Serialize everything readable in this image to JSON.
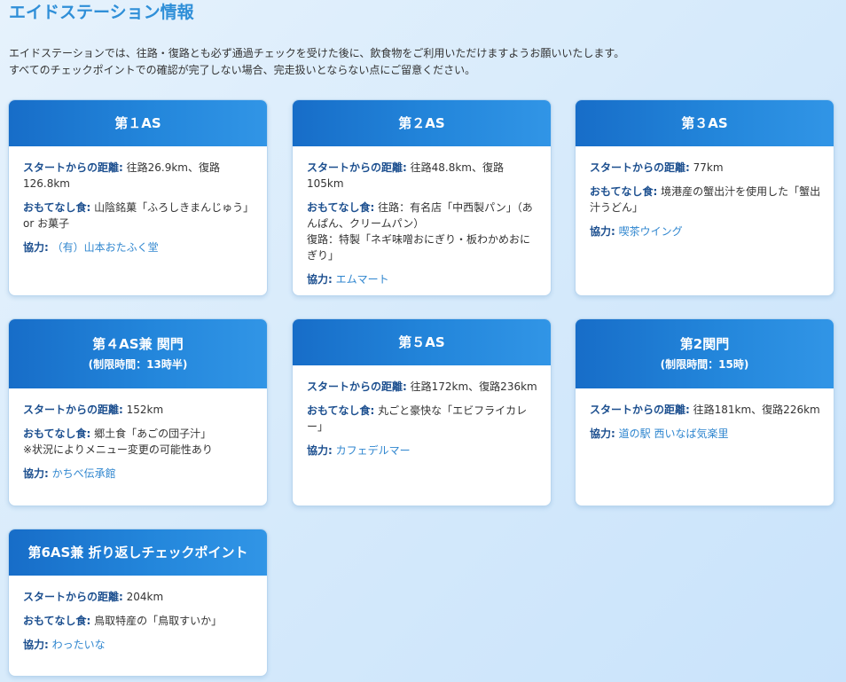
{
  "page": {
    "title": "エイドステーション情報",
    "intro_line1": "エイドステーションでは、往路・復路とも必ず通過チェックを受けた後に、飲食物をご利用いただけますようお願いいたします。",
    "intro_line2": "すべてのチェックポイントでの確認が完了しない場合、完走扱いとならない点にご留意ください。"
  },
  "labels": {
    "distance": "スタートからの距離:",
    "food": "おもてなし食:",
    "partner": "協力:"
  },
  "cards": [
    {
      "title": "第１AS",
      "subtitle": "",
      "distance": "往路26.9km、復路126.8km",
      "food": [
        "山陰銘菓「ふろしきまんじゅう」or お菓子"
      ],
      "partner": "（有）山本おたふく堂"
    },
    {
      "title": "第２AS",
      "subtitle": "",
      "distance": "往路48.8km、復路105km",
      "food": [
        "往路：有名店「中西製パン」（あんぱん、クリームパン）",
        "復路：特製「ネギ味噌おにぎり・板わかめおにぎり」"
      ],
      "partner": "エムマート"
    },
    {
      "title": "第３AS",
      "subtitle": "",
      "distance": "77km",
      "food": [
        "境港産の蟹出汁を使用した「蟹出汁うどん」"
      ],
      "partner": "喫茶ウイング"
    },
    {
      "title": "第４AS兼 関門",
      "subtitle": "(制限時間：13時半)",
      "distance": "152km",
      "food": [
        "郷土食「あごの団子汁」",
        "※状況によりメニュー変更の可能性あり"
      ],
      "partner": "かちべ伝承館"
    },
    {
      "title": "第５AS",
      "subtitle": "",
      "distance": "往路172km、復路236km",
      "food": [
        "丸ごと豪快な「エビフライカレー」"
      ],
      "partner": "カフェデルマー"
    },
    {
      "title": "第2関門",
      "subtitle": "(制限時間：15時)",
      "distance": "往路181km、復路226km",
      "food": [],
      "partner": "道の駅 西いなば気楽里"
    },
    {
      "title": "第6AS兼 折り返しチェックポイント",
      "subtitle": "",
      "distance": "204km",
      "food": [
        "鳥取特産の「鳥取すいか」"
      ],
      "partner": "わったいな"
    }
  ]
}
